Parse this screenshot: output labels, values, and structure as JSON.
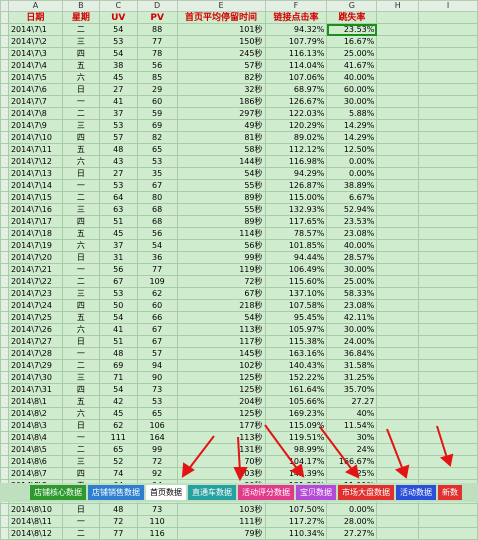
{
  "columns": [
    "A",
    "B",
    "C",
    "D",
    "E",
    "F",
    "G",
    "H",
    "I"
  ],
  "headers": [
    "日期",
    "星期",
    "UV",
    "PV",
    "首页平均停留时间",
    "链接点击率",
    "跳失率",
    "",
    ""
  ],
  "rows": [
    [
      "2014\\7\\1",
      "二",
      "54",
      "88",
      "101秒",
      "94.32%",
      "23.53%"
    ],
    [
      "2014\\7\\2",
      "三",
      "53",
      "77",
      "150秒",
      "107.79%",
      "16.67%"
    ],
    [
      "2014\\7\\3",
      "四",
      "54",
      "78",
      "245秒",
      "116.13%",
      "25.00%"
    ],
    [
      "2014\\7\\4",
      "五",
      "38",
      "56",
      "57秒",
      "114.04%",
      "41.67%"
    ],
    [
      "2014\\7\\5",
      "六",
      "45",
      "85",
      "82秒",
      "107.06%",
      "40.00%"
    ],
    [
      "2014\\7\\6",
      "日",
      "27",
      "29",
      "32秒",
      "68.97%",
      "60.00%"
    ],
    [
      "2014\\7\\7",
      "一",
      "41",
      "60",
      "186秒",
      "126.67%",
      "30.00%"
    ],
    [
      "2014\\7\\8",
      "二",
      "37",
      "59",
      "297秒",
      "122.03%",
      "5.88%"
    ],
    [
      "2014\\7\\9",
      "三",
      "53",
      "69",
      "49秒",
      "120.29%",
      "14.29%"
    ],
    [
      "2014\\7\\10",
      "四",
      "57",
      "82",
      "81秒",
      "89.02%",
      "14.29%"
    ],
    [
      "2014\\7\\11",
      "五",
      "48",
      "65",
      "58秒",
      "112.12%",
      "12.50%"
    ],
    [
      "2014\\7\\12",
      "六",
      "43",
      "53",
      "144秒",
      "116.98%",
      "0.00%"
    ],
    [
      "2014\\7\\13",
      "日",
      "27",
      "35",
      "54秒",
      "94.29%",
      "0.00%"
    ],
    [
      "2014\\7\\14",
      "一",
      "53",
      "67",
      "55秒",
      "126.87%",
      "38.89%"
    ],
    [
      "2014\\7\\15",
      "二",
      "64",
      "80",
      "89秒",
      "115.00%",
      "6.67%"
    ],
    [
      "2014\\7\\16",
      "三",
      "63",
      "68",
      "55秒",
      "132.93%",
      "52.94%"
    ],
    [
      "2014\\7\\17",
      "四",
      "51",
      "68",
      "89秒",
      "117.65%",
      "23.53%"
    ],
    [
      "2014\\7\\18",
      "五",
      "45",
      "56",
      "114秒",
      "78.57%",
      "23.08%"
    ],
    [
      "2014\\7\\19",
      "六",
      "37",
      "54",
      "56秒",
      "101.85%",
      "40.00%"
    ],
    [
      "2014\\7\\20",
      "日",
      "31",
      "36",
      "99秒",
      "94.44%",
      "28.57%"
    ],
    [
      "2014\\7\\21",
      "一",
      "56",
      "77",
      "119秒",
      "106.49%",
      "30.00%"
    ],
    [
      "2014\\7\\22",
      "二",
      "67",
      "109",
      "72秒",
      "115.60%",
      "25.00%"
    ],
    [
      "2014\\7\\23",
      "三",
      "53",
      "62",
      "67秒",
      "137.10%",
      "58.33%"
    ],
    [
      "2014\\7\\24",
      "四",
      "50",
      "60",
      "218秒",
      "107.58%",
      "23.08%"
    ],
    [
      "2014\\7\\25",
      "五",
      "54",
      "66",
      "54秒",
      "95.45%",
      "42.11%"
    ],
    [
      "2014\\7\\26",
      "六",
      "41",
      "67",
      "113秒",
      "105.97%",
      "30.00%"
    ],
    [
      "2014\\7\\27",
      "日",
      "51",
      "67",
      "117秒",
      "115.38%",
      "24.00%"
    ],
    [
      "2014\\7\\28",
      "一",
      "48",
      "57",
      "145秒",
      "163.16%",
      "36.84%"
    ],
    [
      "2014\\7\\29",
      "二",
      "69",
      "94",
      "102秒",
      "140.43%",
      "31.58%"
    ],
    [
      "2014\\7\\30",
      "三",
      "71",
      "90",
      "125秒",
      "152.22%",
      "31.25%"
    ],
    [
      "2014\\7\\31",
      "四",
      "54",
      "73",
      "125秒",
      "161.64%",
      "35.70%"
    ],
    [
      "2014\\8\\1",
      "五",
      "42",
      "53",
      "204秒",
      "105.66%",
      "27.27"
    ],
    [
      "2014\\8\\2",
      "六",
      "45",
      "65",
      "125秒",
      "169.23%",
      "40%"
    ],
    [
      "2014\\8\\3",
      "日",
      "62",
      "106",
      "177秒",
      "115.09%",
      "11.54%"
    ],
    [
      "2014\\8\\4",
      "一",
      "111",
      "164",
      "113秒",
      "119.51%",
      "30%"
    ],
    [
      "2014\\8\\5",
      "二",
      "65",
      "99",
      "131秒",
      "98.99%",
      "24%"
    ],
    [
      "2014\\8\\6",
      "三",
      "52",
      "72",
      "70秒",
      "104.17%",
      "166.67%"
    ],
    [
      "2014\\8\\7",
      "四",
      "74",
      "92",
      "103秒",
      "142.39%",
      "25%"
    ],
    [
      "2014\\8\\8",
      "五",
      "64",
      "94",
      "90秒",
      "121.28%",
      "11.11%"
    ],
    [
      "2014\\8\\9",
      "六",
      "57",
      "85",
      "113秒",
      "116.47%",
      "15.79%"
    ],
    [
      "2014\\8\\10",
      "日",
      "48",
      "73",
      "103秒",
      "107.50%",
      "0.00%"
    ],
    [
      "2014\\8\\11",
      "一",
      "72",
      "110",
      "111秒",
      "117.27%",
      "28.00%"
    ],
    [
      "2014\\8\\12",
      "二",
      "77",
      "116",
      "79秒",
      "110.34%",
      "27.27%"
    ]
  ],
  "tabs": [
    {
      "label": "店铺核心数据",
      "color": "#2e9a2e"
    },
    {
      "label": "店铺销售数据",
      "color": "#2e7fd0"
    },
    {
      "label": "首页数据",
      "color": "#ffffff"
    },
    {
      "label": "直通车数据",
      "color": "#26a0a0"
    },
    {
      "label": "活动评分数据",
      "color": "#e23a8a"
    },
    {
      "label": "宝贝数据",
      "color": "#b44ad8"
    },
    {
      "label": "市场大盘数据",
      "color": "#e0302f"
    },
    {
      "label": "活动数据",
      "color": "#2a4fd8"
    },
    {
      "label": "新数",
      "color": "#e03030"
    }
  ]
}
